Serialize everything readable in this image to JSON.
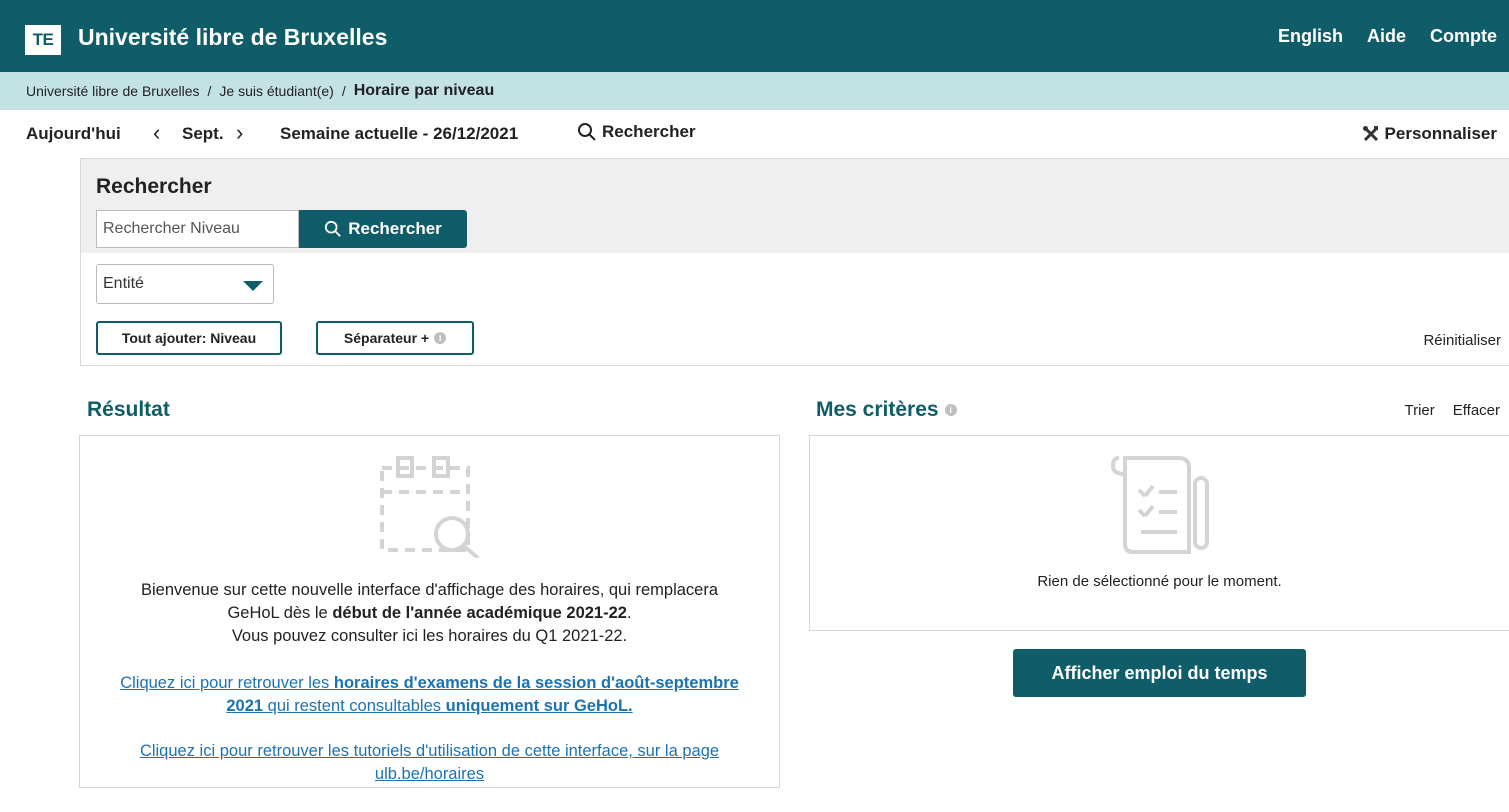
{
  "header": {
    "logo": "TE",
    "title": "Université libre de Bruxelles",
    "links": [
      "English",
      "Aide",
      "Compte"
    ]
  },
  "breadcrumb": {
    "items": [
      "Université libre de Bruxelles",
      "Je suis étudiant(e)"
    ],
    "separator": "/",
    "current": "Horaire par niveau"
  },
  "toolbar": {
    "today": "Aujourd'hui",
    "prev": "‹",
    "month": "Sept.",
    "next": "›",
    "week": "Semaine actuelle - 26/12/2021",
    "search": "Rechercher",
    "customize": "Personnaliser"
  },
  "search_panel": {
    "title": "Rechercher",
    "input_placeholder": "Rechercher Niveau",
    "search_button": "Rechercher",
    "entity_select": "Entité",
    "add_all_button": "Tout ajouter: Niveau",
    "separator_button": "Séparateur +",
    "reset": "Réinitialiser"
  },
  "result": {
    "title": "Résultat",
    "welcome_line1": "Bienvenue sur cette nouvelle interface d'affichage des horaires, qui remplacera",
    "welcome_line2_pre": "GeHoL dès le ",
    "welcome_line2_bold": "début de l'année académique 2021-22",
    "welcome_line2_post": ".",
    "welcome_line3": "Vous pouvez consulter ici les horaires du Q1 2021-22.",
    "link1_pre": "Cliquez ici pour retrouver les ",
    "link1_bold1": "horaires d'examens de la session d'août-septembre",
    "link1_bold2": "2021",
    "link1_mid": " qui restent consultables ",
    "link1_bold3": "uniquement sur GeHoL.",
    "link2_line1": "Cliquez ici pour retrouver les tutoriels d'utilisation de cette interface, sur la page",
    "link2_line2": "ulb.be/horaires"
  },
  "criteria": {
    "title": "Mes critères",
    "sort": "Trier",
    "clear": "Effacer",
    "empty": "Rien de sélectionné pour le moment.",
    "show_button": "Afficher emploi du temps"
  },
  "icons": {
    "search": "search-icon",
    "tools": "tools-icon",
    "info": "info-icon",
    "empty_result": "calendar-search-icon",
    "empty_criteria": "checklist-pen-icon"
  },
  "colors": {
    "primary": "#0f5d68",
    "breadcrumb_bg": "#c3e2e4",
    "link": "#1a73b3"
  }
}
